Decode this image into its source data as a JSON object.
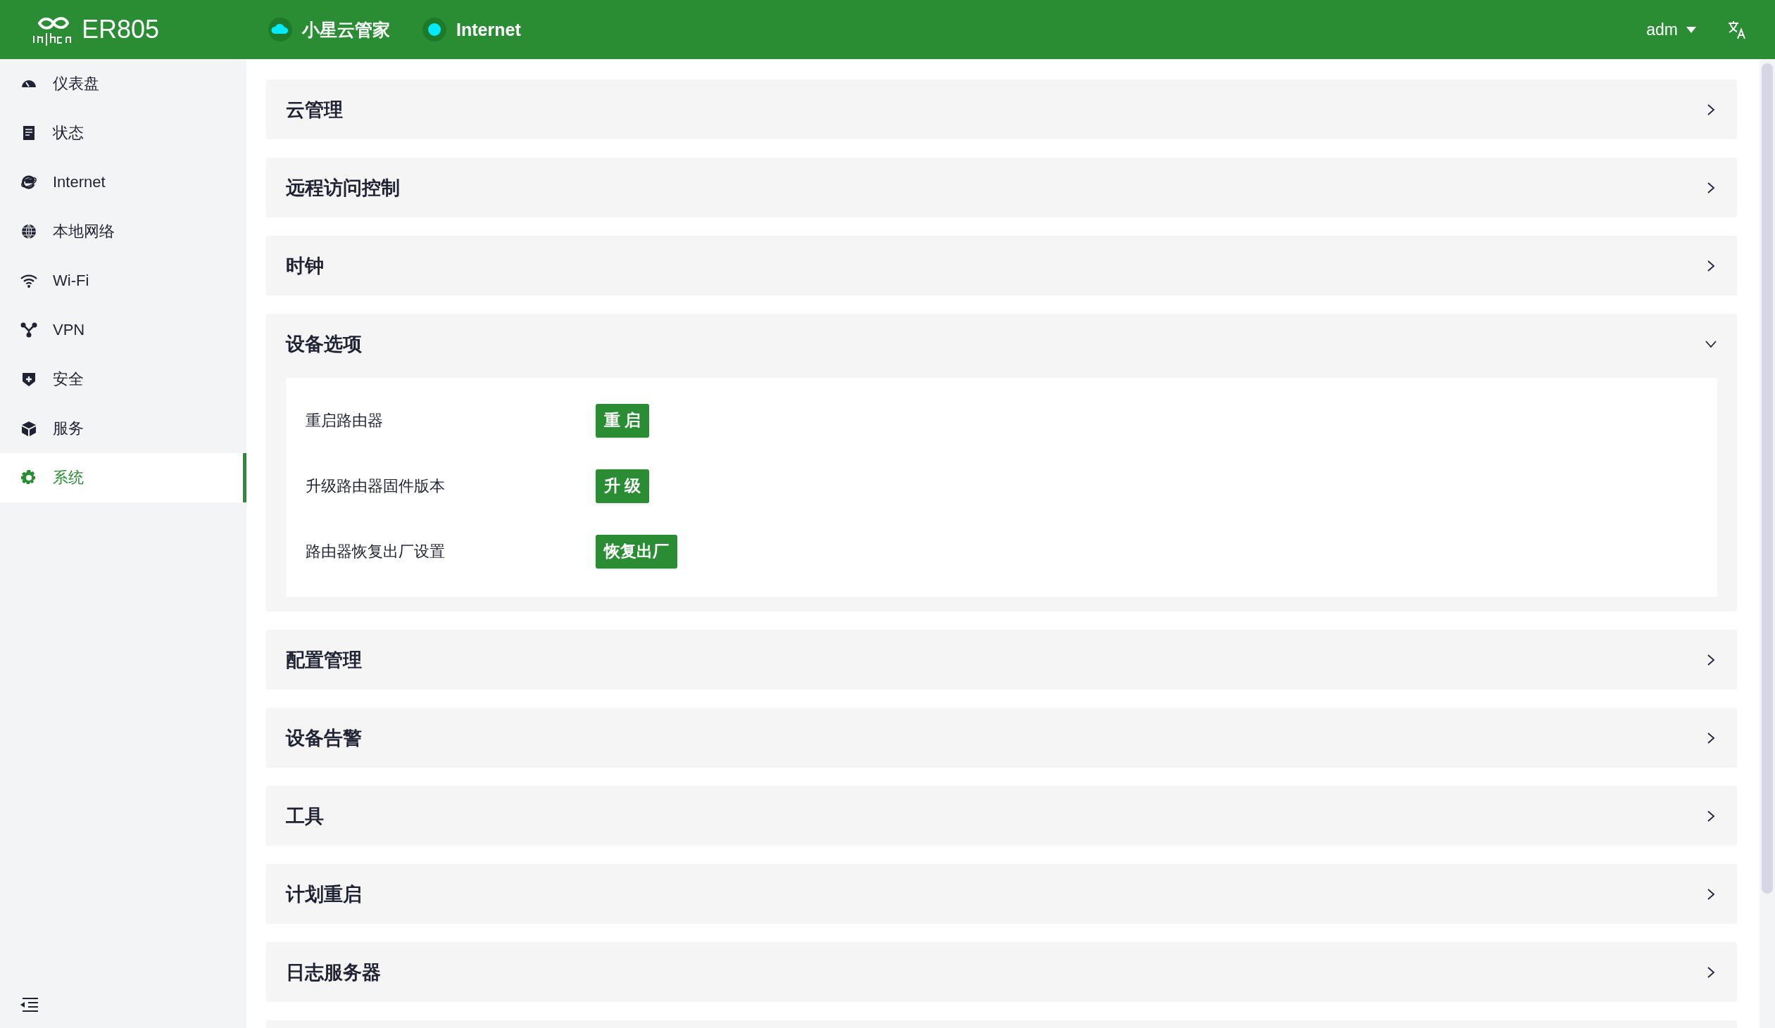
{
  "header": {
    "product": "ER805",
    "status": [
      {
        "kind": "cloud",
        "label": "小星云管家"
      },
      {
        "kind": "dot",
        "label": "Internet"
      }
    ],
    "user": "adm"
  },
  "sidebar": {
    "items": [
      {
        "label": "仪表盘",
        "selected": false
      },
      {
        "label": "状态",
        "selected": false
      },
      {
        "label": "Internet",
        "selected": false
      },
      {
        "label": "本地网络",
        "selected": false
      },
      {
        "label": "Wi-Fi",
        "selected": false
      },
      {
        "label": "VPN",
        "selected": false
      },
      {
        "label": "安全",
        "selected": false
      },
      {
        "label": "服务",
        "selected": false
      },
      {
        "label": "系统",
        "selected": true
      }
    ]
  },
  "panels": [
    {
      "title": "云管理",
      "expanded": false
    },
    {
      "title": "远程访问控制",
      "expanded": false
    },
    {
      "title": "时钟",
      "expanded": false
    },
    {
      "title": "设备选项",
      "expanded": true,
      "rows": [
        {
          "label": "重启路由器",
          "button": "重 启"
        },
        {
          "label": "升级路由器固件版本",
          "button": "升 级"
        },
        {
          "label": "路由器恢复出厂设置",
          "button": "恢复出厂"
        }
      ]
    },
    {
      "title": "配置管理",
      "expanded": false
    },
    {
      "title": "设备告警",
      "expanded": false
    },
    {
      "title": "工具",
      "expanded": false
    },
    {
      "title": "计划重启",
      "expanded": false
    },
    {
      "title": "日志服务器",
      "expanded": false
    }
  ]
}
